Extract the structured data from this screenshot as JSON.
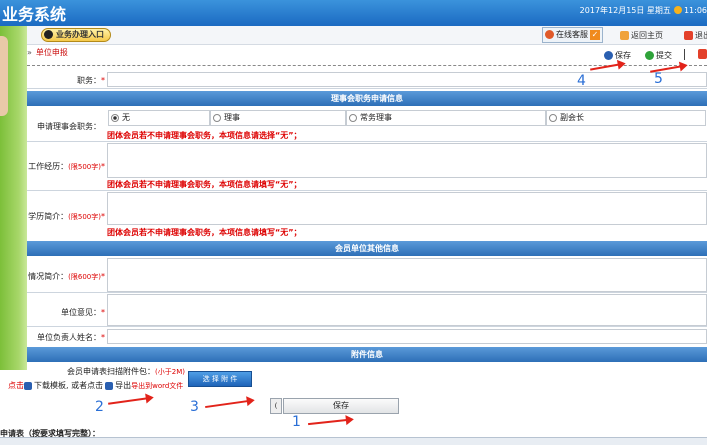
{
  "header": {
    "title": "业务系统",
    "date": "2017年12月15日 星期五",
    "time": "11:06"
  },
  "toolbar": {
    "business_entry": "业务办理入口",
    "online_service": "在线客服",
    "back_home": "返回主页",
    "logout": "退出"
  },
  "breadcrumb": "单位申报",
  "actions": {
    "save": "保存",
    "submit": "提交"
  },
  "annotations": [
    "1",
    "2",
    "3",
    "4",
    "5"
  ],
  "form": {
    "position_label": "职务：",
    "section_council": "理事会职务申请信息",
    "council_label": "申请理事会职务：",
    "council_options": [
      "无",
      "理事",
      "常务理事",
      "副会长"
    ],
    "council_selected": "无",
    "note_select_none": "团体会员若不申请理事会职务，本项信息请选择“无”；",
    "work_label": "工作经历：",
    "work_limit": "(限500字)",
    "note_fill_none": "团体会员若不申请理事会职务，本项信息请填写“无”；",
    "edu_label": "学历简介：",
    "edu_limit": "(限500字)",
    "note_fill_none_2": "团体会员若不申请理事会职务，本项信息请填写“无”；",
    "section_other": "会员单位其他信息",
    "intro_label": "情况简介：",
    "intro_limit": "(限600字)",
    "opinion_label": "单位意见：",
    "leader_label": "单位负责人姓名：",
    "section_attach": "附件信息",
    "attach_label": "会员申请表扫描附件包：",
    "attach_limit": "(小于2M)",
    "choose_btn": "选 择 附 件",
    "download_prefix": "点击",
    "download_mid": "下载模板, 或者点击",
    "export_label": "导出",
    "export_suffix": "导出到word文件",
    "save_btn": "保存",
    "small_btn": "("
  },
  "bottom_title": "申请表（按要求填写完整）：",
  "colors": {
    "header_blue": "#1b6ac2",
    "section_blue": "#2d6fb7",
    "note_red": "#dd0000",
    "annotation_blue": "#2a6fd6",
    "arrow_red": "#e2231a"
  }
}
